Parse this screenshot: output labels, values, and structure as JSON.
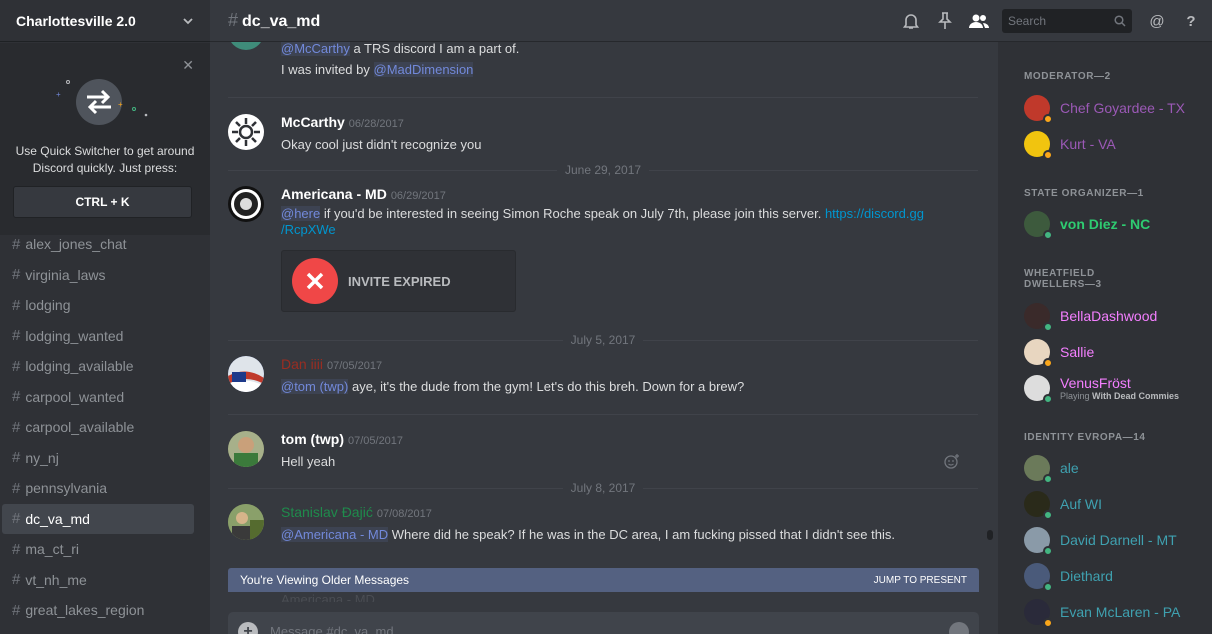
{
  "server": {
    "name": "Charlottesville 2.0"
  },
  "quick_switcher": {
    "text": "Use Quick Switcher to get around Discord quickly. Just press:",
    "shortcut": "CTRL + K"
  },
  "channels": [
    {
      "name": "alex_jones_chat"
    },
    {
      "name": "virginia_laws"
    },
    {
      "name": "lodging"
    },
    {
      "name": "lodging_wanted"
    },
    {
      "name": "lodging_available"
    },
    {
      "name": "carpool_wanted"
    },
    {
      "name": "carpool_available"
    },
    {
      "name": "ny_nj"
    },
    {
      "name": "pennsylvania"
    },
    {
      "name": "dc_va_md",
      "active": true
    },
    {
      "name": "ma_ct_ri"
    },
    {
      "name": "vt_nh_me"
    },
    {
      "name": "great_lakes_region"
    }
  ],
  "topbar": {
    "channel": "dc_va_md",
    "search_placeholder": "Search"
  },
  "messages": {
    "m0": {
      "mention1": "@McCarthy",
      "text1": " a TRS discord I am a part of.",
      "text2": "I was invited by ",
      "mention2": "@MadDimension"
    },
    "m1": {
      "user": "McCarthy",
      "ts": "06/28/2017",
      "text": "Okay cool just didn't recognize you",
      "color": "#ffffff"
    },
    "d1": "June 29, 2017",
    "m2": {
      "user": "Americana - MD",
      "ts": "06/29/2017",
      "mention": "@here",
      "text": " if you'd be interested in seeing Simon Roche speak on July 7th, please join this server. ",
      "link1": "https://discord.gg",
      "link2": "/RcpXWe",
      "invite": "INVITE EXPIRED",
      "color": "#ffffff"
    },
    "d2": "July 5, 2017",
    "m3": {
      "user": "Dan iiii",
      "ts": "07/05/2017",
      "mention": "@tom (twp)",
      "text": " aye, it's the dude from the gym! Let's do this breh. Down for a brew?",
      "color": "#992d22"
    },
    "m4": {
      "user": "tom (twp)",
      "ts": "07/05/2017",
      "text": "Hell yeah",
      "color": "#ffffff"
    },
    "d3": "July 8, 2017",
    "m5": {
      "user": "Stanislav Đajić",
      "ts": "07/08/2017",
      "mention": "@Americana - MD",
      "text": " Where did he speak? If he was in the DC area, I am fucking pissed that I didn't see this.",
      "color": "#1f8b4c"
    }
  },
  "older_bar": {
    "label": "You're Viewing Older Messages",
    "action": "JUMP TO PRESENT",
    "behind": "Americana - MD"
  },
  "input": {
    "placeholder": "Message #dc_va_md"
  },
  "members": {
    "g1": "MODERATOR—2",
    "g2": "STATE ORGANIZER—1",
    "g3": "WHEATFIELD DWELLERS—3",
    "g4": "IDENTITY EVROPA—14",
    "list": [
      {
        "name": "Chef Goyardee - TX",
        "color": "#9b59b6",
        "status": "#faa61a"
      },
      {
        "name": "Kurt - VA",
        "color": "#9b59b6",
        "status": "#faa61a"
      },
      {
        "name": "von Diez - NC",
        "color": "#2ecc71",
        "status": "#43b581"
      },
      {
        "name": "BellaDashwood",
        "color": "#f47fff",
        "status": "#43b581"
      },
      {
        "name": "Sallie",
        "color": "#f47fff",
        "status": "#faa61a"
      },
      {
        "name": "VenusFröst",
        "color": "#f47fff",
        "status": "#43b581",
        "sub_prefix": "Playing ",
        "sub_game": "With Dead Commies"
      },
      {
        "name": "ale",
        "color": "#3fa1b0",
        "status": "#43b581"
      },
      {
        "name": "Auf WI",
        "color": "#3fa1b0",
        "status": "#43b581"
      },
      {
        "name": "David Darnell - MT",
        "color": "#3fa1b0",
        "status": "#43b581"
      },
      {
        "name": "Diethard",
        "color": "#3fa1b0",
        "status": "#43b581"
      },
      {
        "name": "Evan McLaren - PA",
        "color": "#3fa1b0",
        "status": "#faa61a"
      }
    ]
  }
}
